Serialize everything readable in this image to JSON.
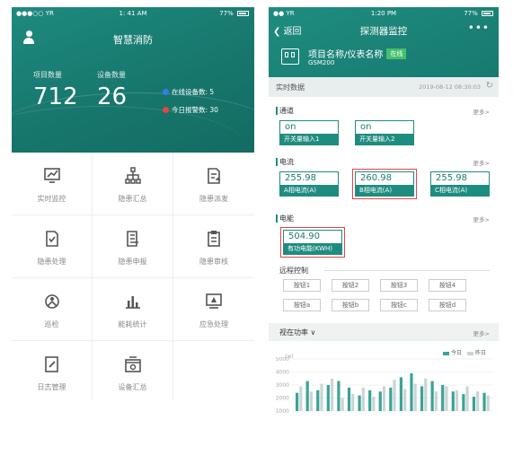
{
  "left": {
    "status": {
      "carrier": "●●●○○ YR",
      "time": "1: 41 AM",
      "battery": "77%"
    },
    "app_title": "智慧消防",
    "stats": [
      {
        "label": "项目数量",
        "value": "712"
      },
      {
        "label": "设备数量",
        "value": "26"
      }
    ],
    "online_label": "在线设备数: 5",
    "alarm_label": "今日报警数: 30",
    "colors": {
      "accent": "#1f8c80",
      "online_dot": "#2f7fe6",
      "alarm_dot": "#e6463c"
    },
    "menu": [
      {
        "label": "实时监控",
        "icon": "monitor-chart-icon"
      },
      {
        "label": "隐患汇总",
        "icon": "hierarchy-icon"
      },
      {
        "label": "隐患派发",
        "icon": "document-arrow-icon"
      },
      {
        "label": "隐患处理",
        "icon": "document-check-icon"
      },
      {
        "label": "隐患申报",
        "icon": "document-list-icon"
      },
      {
        "label": "隐患审核",
        "icon": "clipboard-icon"
      },
      {
        "label": "巡检",
        "icon": "patrol-icon"
      },
      {
        "label": "能耗统计",
        "icon": "bar-chart-icon"
      },
      {
        "label": "应急处理",
        "icon": "monitor-alert-icon"
      },
      {
        "label": "日志管理",
        "icon": "edit-note-icon"
      },
      {
        "label": "设备汇总",
        "icon": "device-box-icon"
      }
    ]
  },
  "right": {
    "status": {
      "carrier": "●● YR",
      "time": "1:20 PM",
      "battery": "77%"
    },
    "back_label": "返回",
    "page_title": "探测器监控",
    "more_label": "•••",
    "device_name": "项目名称/仪表名称",
    "online_badge": "在线",
    "device_code": "GSM200",
    "realtime_label": "实时数据",
    "realtime_date": "2019-08-12 08:30:03",
    "sections": {
      "channel": {
        "title": "通道",
        "more": "更多>",
        "items": [
          {
            "value": "on",
            "label": "开关量输入1"
          },
          {
            "value": "on",
            "label": "开关量输入2"
          }
        ]
      },
      "current": {
        "title": "电流",
        "more": "更多>",
        "items": [
          {
            "value": "255.98",
            "label": "A相电流(A)"
          },
          {
            "value": "260.98",
            "label": "B相电流(A)"
          },
          {
            "value": "255.98",
            "label": "C相电流(A)"
          }
        ]
      },
      "energy": {
        "title": "电能",
        "more": "更多>",
        "items": [
          {
            "value": "504.90",
            "label": "有功电能(KWH)"
          }
        ]
      }
    },
    "remote_label": "远程控制",
    "buttons_row1": [
      "按钮1",
      "按钮2",
      "按钮3",
      "按钮4"
    ],
    "buttons_row2": [
      "按钮a",
      "按钮b",
      "按钮c",
      "按钮d"
    ],
    "power_label": "视在功率 ∨",
    "power_more": "更多>",
    "chart_unit": "(w)",
    "legend_today": "今日",
    "legend_yesterday": "昨日"
  },
  "chart_data": {
    "type": "bar",
    "ylabel": "(w)",
    "yticks": [
      1000,
      2000,
      3000,
      4000,
      5000
    ],
    "ylim": [
      1000,
      5000
    ],
    "series": [
      {
        "name": "今日",
        "color": "#3aa396",
        "values": [
          2400,
          3300,
          2600,
          3000,
          3300,
          2800,
          2200,
          2600,
          2500,
          2800,
          3600,
          3900,
          2900,
          3300,
          3000,
          2500,
          2300,
          2100,
          2400
        ]
      },
      {
        "name": "昨日",
        "color": "#c9d6d4",
        "values": [
          2900,
          2500,
          3100,
          3500,
          2000,
          2300,
          2800,
          2100,
          2900,
          3400,
          2700,
          3100,
          3500,
          2500,
          2900,
          2600,
          2900,
          2500,
          2200
        ]
      }
    ]
  }
}
